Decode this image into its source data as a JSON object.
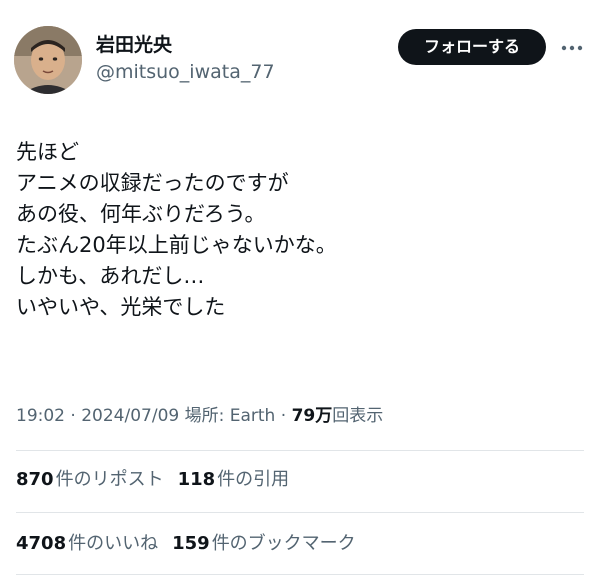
{
  "user": {
    "display_name": "岩田光央",
    "handle": "@mitsuo_iwata_77",
    "avatar_icon": "profile-photo"
  },
  "follow_label": "フォローする",
  "more_icon": "more-horizontal-icon",
  "tweet": {
    "lines": [
      "先ほど",
      "アニメの収録だったのですが",
      "あの役、何年ぶりだろう。",
      "たぶん20年以上前じゃないかな。",
      "しかも、あれだし…",
      "いやいや、光栄でした"
    ]
  },
  "meta": {
    "time": "19:02",
    "sep1": " · ",
    "date": "2024/07/09",
    "sep2": " ",
    "location": "場所: Earth",
    "sep3": " · ",
    "views_count": "79万",
    "views_label": "回表示"
  },
  "stats": {
    "reposts": {
      "count": "870",
      "label": "件のリポスト"
    },
    "quotes": {
      "count": "118",
      "label": "件の引用"
    },
    "likes": {
      "count": "4708",
      "label": "件のいいね"
    },
    "bookmarks": {
      "count": "159",
      "label": "件のブックマーク"
    }
  },
  "colors": {
    "text_primary": "#0f1419",
    "text_secondary": "#536471",
    "button_bg": "#0f1419",
    "divider": "#e1e5e8"
  }
}
